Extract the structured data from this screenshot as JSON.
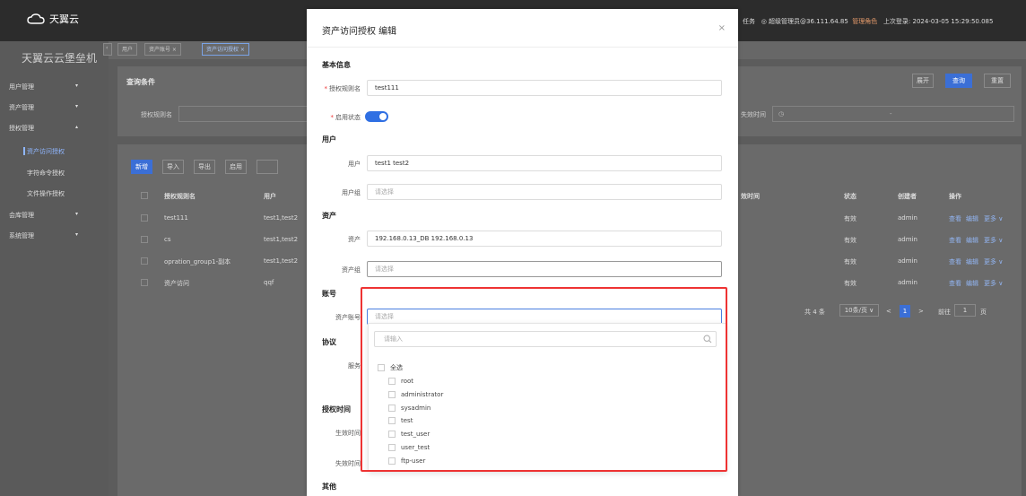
{
  "app": {
    "logo_text": "天翼云",
    "brand": "天翼云云堡垒机"
  },
  "topbar": {
    "tasks": "任务",
    "user": "超级管理员@36.111.64.85",
    "role": "管理角色",
    "last_login": "上次登录: 2024-03-05 15:29:50.085"
  },
  "sidebar": {
    "items": [
      {
        "label": "用户管理",
        "arrow": "▾"
      },
      {
        "label": "资产管理",
        "arrow": "▾"
      },
      {
        "label": "授权管理",
        "arrow": "▴"
      },
      {
        "label": "会库管理",
        "arrow": "▾"
      },
      {
        "label": "系统管理",
        "arrow": "▾"
      }
    ],
    "subitems": [
      "资产访问授权",
      "字符命令授权",
      "文件操作授权"
    ]
  },
  "tabs": [
    "用户",
    "资产账号 ×",
    "资产访问授权 ×"
  ],
  "query": {
    "title": "查询条件",
    "expand": "展开",
    "search": "查询",
    "reset": "重置",
    "rule_label": "授权规则名",
    "expire_label": "失效时间",
    "expire_sep": "-"
  },
  "toolbar": {
    "add": "新增",
    "import": "导入",
    "export": "导出",
    "enable": "启用"
  },
  "table": {
    "headers": {
      "name": "授权规则名",
      "user": "用户",
      "time": "效时间",
      "status": "状态",
      "creator": "创建者",
      "ops": "操作"
    },
    "rows": [
      {
        "name": "test111",
        "user": "test1,test2",
        "status": "有效",
        "creator": "admin"
      },
      {
        "name": "cs",
        "user": "test1,test2",
        "status": "有效",
        "creator": "admin"
      },
      {
        "name": "opration_group1-副本",
        "user": "test1,test2",
        "status": "有效",
        "creator": "admin"
      },
      {
        "name": "资产访问",
        "user": "qqf",
        "status": "有效",
        "creator": "admin"
      }
    ],
    "op_view": "查看",
    "op_edit": "编辑",
    "op_more": "更多 ∨"
  },
  "pagination": {
    "total": "共 4 条",
    "size": "10条/页",
    "goto": "前往",
    "page": "1",
    "page_unit": "页",
    "current": "1",
    "prev": "<",
    "next": ">"
  },
  "modal": {
    "title": "资产访问授权 编辑",
    "close": "×",
    "sections": {
      "basic": "基本信息",
      "user": "用户",
      "asset": "资产",
      "account": "账号",
      "protocol": "协议",
      "time": "授权时间",
      "other": "其他"
    },
    "fields": {
      "rule_name_label": "授权规则名",
      "rule_name": "test111",
      "enable_label": "启用状态",
      "user_label": "用户",
      "user_value": "test1  test2",
      "usergroup_label": "用户组",
      "usergroup_placeholder": "请选择",
      "asset_label": "资产",
      "asset_value": "192.168.0.13_DB  192.168.0.13",
      "assetgroup_label": "资产组",
      "assetgroup_placeholder": "请选择",
      "account_label": "资产账号",
      "account_placeholder": "请选择",
      "service_label": "服务",
      "effective_label": "生效时间",
      "expire_label": "失效时间"
    }
  },
  "dropdown": {
    "search_placeholder": "请输入",
    "select_all": "全选",
    "options": [
      "root",
      "administrator",
      "sysadmin",
      "test",
      "test_user",
      "user_test",
      "ftp-user"
    ]
  },
  "colors": {
    "primary": "#2f6fe3",
    "highlight": "#e33333",
    "required": "#e33333"
  }
}
